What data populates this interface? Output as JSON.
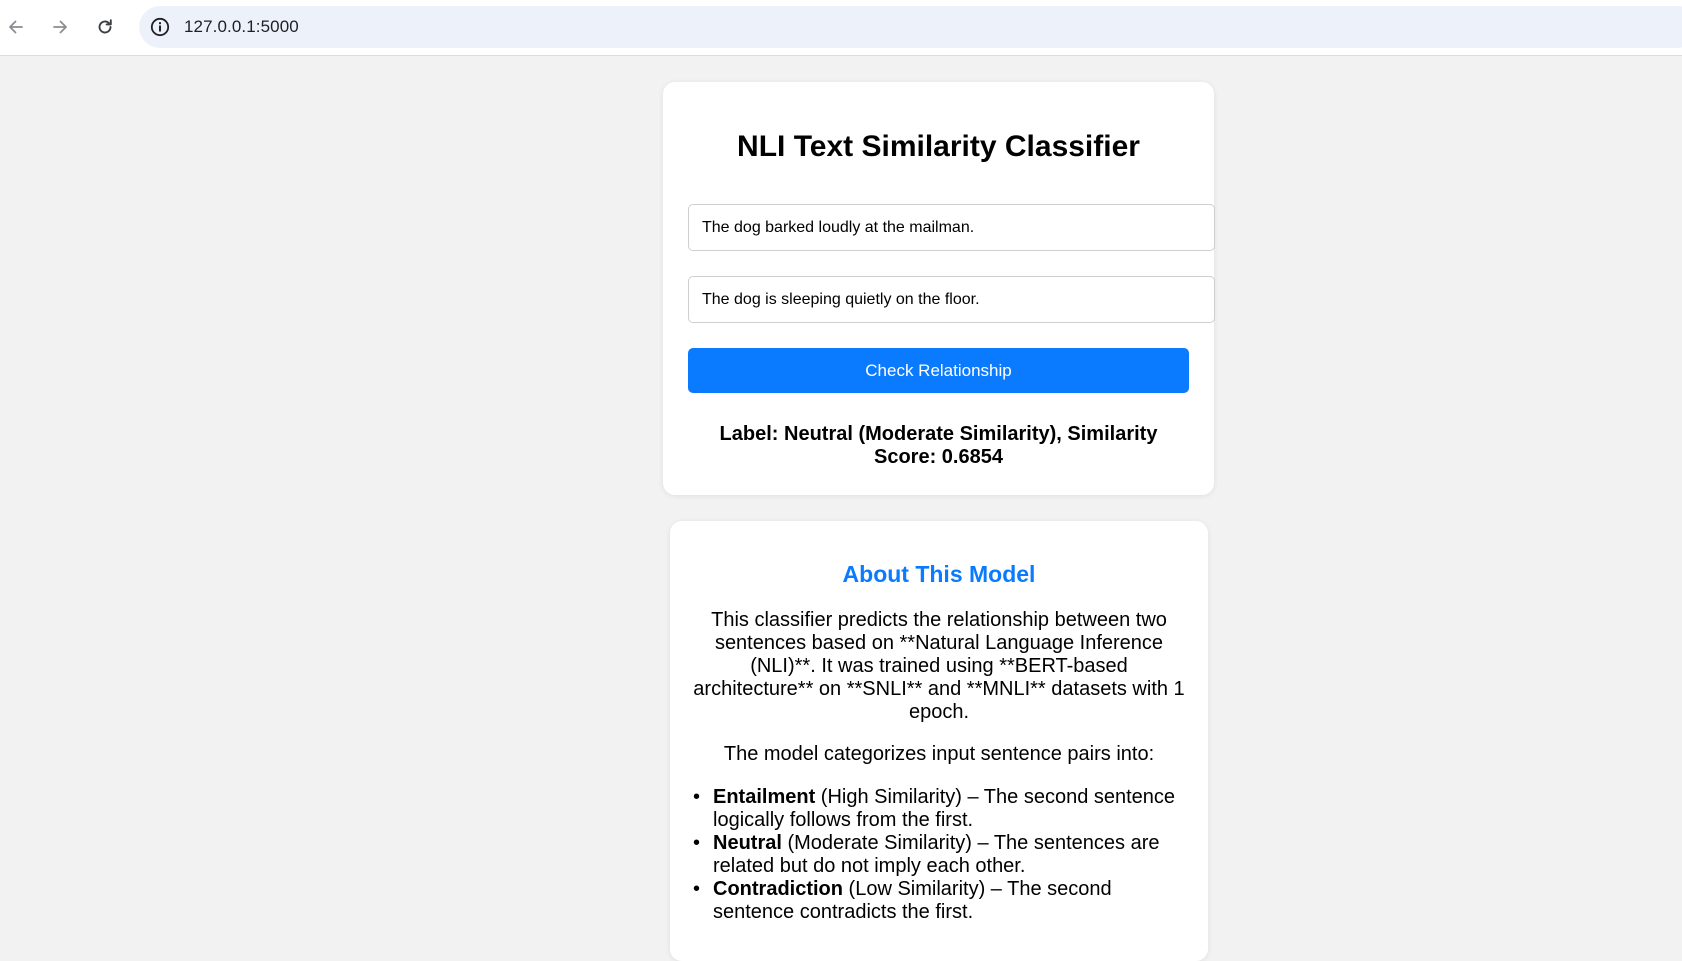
{
  "browser": {
    "url": "127.0.0.1:5000",
    "icons": [
      "back-arrow-icon",
      "forward-arrow-icon",
      "reload-icon",
      "site-info-icon"
    ]
  },
  "main": {
    "title": "NLI Text Similarity Classifier",
    "sentence1": "The dog barked loudly at the mailman.",
    "sentence2": "The dog is sleeping quietly on the floor.",
    "button_label": "Check Relationship",
    "result": "Label: Neutral (Moderate Similarity), Similarity Score: 0.6854"
  },
  "about": {
    "title": "About This Model",
    "description": "This classifier predicts the relationship between two sentences based on **Natural Language Inference (NLI)**. It was trained using **BERT-based architecture** on **SNLI** and **MNLI** datasets with 1 epoch.",
    "intro": "The model categorizes input sentence pairs into:",
    "categories": [
      {
        "name": "Entailment",
        "text": " (High Similarity) – The second sentence logically follows from the first."
      },
      {
        "name": "Neutral",
        "text": " (Moderate Similarity) – The sentences are related but do not imply each other."
      },
      {
        "name": "Contradiction",
        "text": " (Low Similarity) – The second sentence contradicts the first."
      }
    ]
  },
  "colors": {
    "accent": "#0a7bff",
    "page_background": "#f2f2f2",
    "omnibox_background": "#edf2fa"
  }
}
